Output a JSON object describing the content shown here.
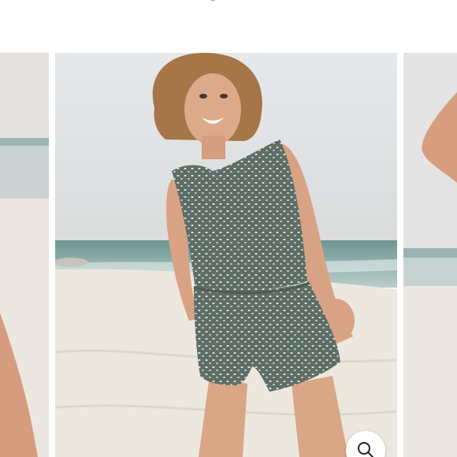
{
  "header": {
    "logo_icon": "brand-logo-mark-icon"
  },
  "gallery": {
    "slides": [
      {
        "role": "previous",
        "alt": ""
      },
      {
        "role": "current",
        "alt": ""
      },
      {
        "role": "next",
        "alt": ""
      }
    ],
    "zoom_icon": "magnifier-icon"
  },
  "colors": {
    "sky": "#dfe3e6",
    "sea": "#7ea3a1",
    "sand": "#ebe5dc",
    "romper": "#5f6f66",
    "skin": "#d9a585",
    "hair": "#a87648"
  }
}
